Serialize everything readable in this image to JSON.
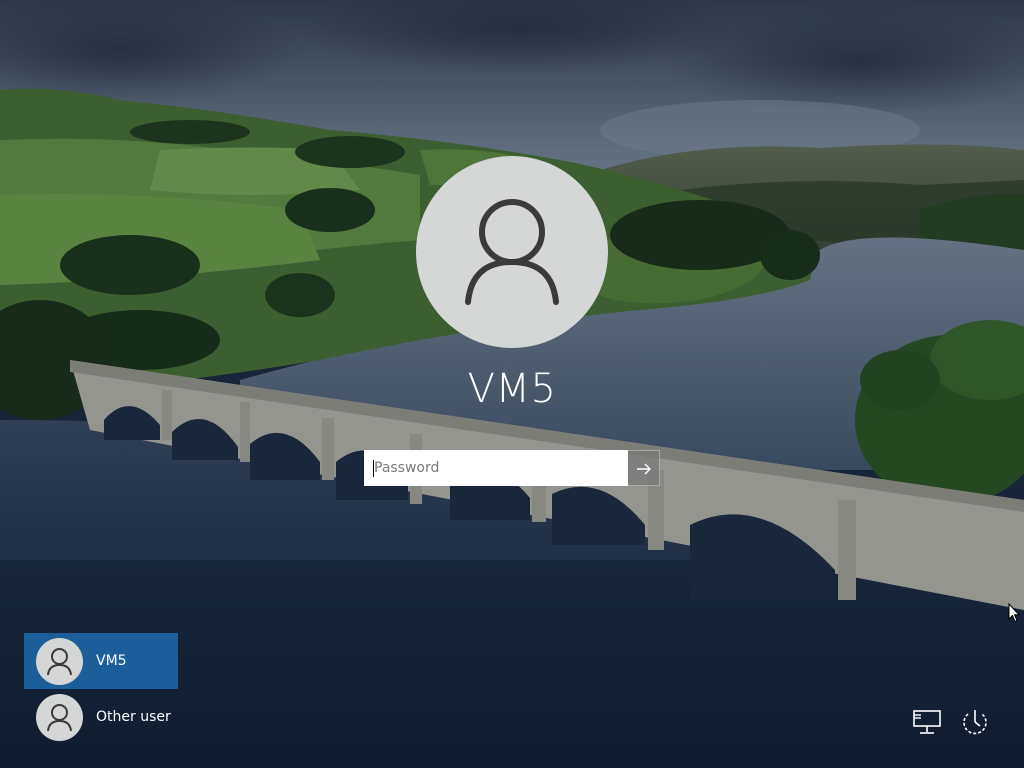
{
  "login": {
    "username": "VM5",
    "password_placeholder": "Password",
    "password_value": ""
  },
  "user_list": {
    "items": [
      {
        "label": "VM5",
        "selected": true
      },
      {
        "label": "Other user",
        "selected": false
      }
    ]
  },
  "system_icons": [
    "network-icon",
    "power-icon"
  ],
  "colors": {
    "selected_user_background": "#1c5e9a",
    "avatar_background": "#d4d7d6",
    "text": "#ffffff"
  }
}
